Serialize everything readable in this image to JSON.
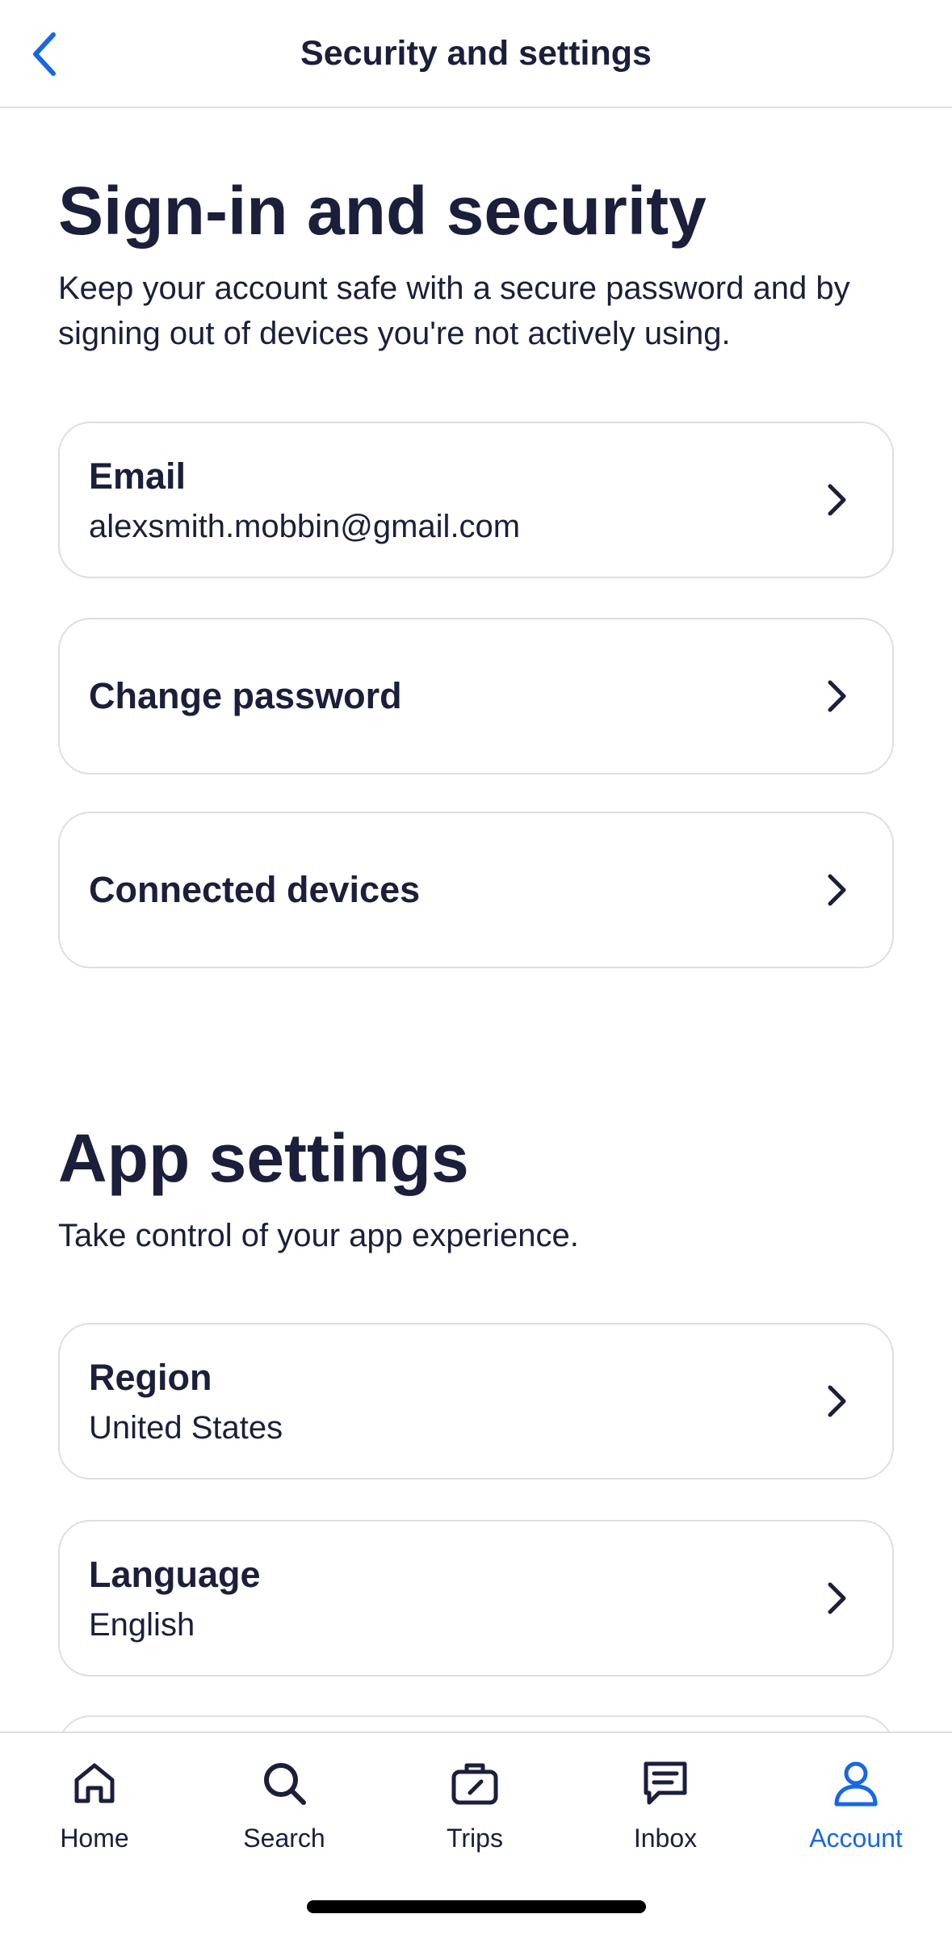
{
  "header": {
    "title": "Security and settings",
    "back_icon": "chevron-left-icon"
  },
  "signin": {
    "title": "Sign-in and security",
    "description": "Keep your account safe with a secure password and by signing out of devices you're not actively using.",
    "items": [
      {
        "label": "Email",
        "value": "alexsmith.mobbin@gmail.com"
      },
      {
        "label": "Change password"
      },
      {
        "label": "Connected devices"
      }
    ]
  },
  "app_settings": {
    "title": "App settings",
    "description": "Take control of your app experience.",
    "items": [
      {
        "label": "Region",
        "value": "United States"
      },
      {
        "label": "Language",
        "value": "English"
      }
    ]
  },
  "tabbar": {
    "tabs": [
      {
        "label": "Home",
        "icon": "home-icon"
      },
      {
        "label": "Search",
        "icon": "search-icon"
      },
      {
        "label": "Trips",
        "icon": "suitcase-icon"
      },
      {
        "label": "Inbox",
        "icon": "message-icon"
      },
      {
        "label": "Account",
        "icon": "user-icon",
        "active": true
      }
    ]
  },
  "colors": {
    "accent": "#1668e3",
    "text": "#1b1f3b",
    "border": "#dcdee3"
  }
}
